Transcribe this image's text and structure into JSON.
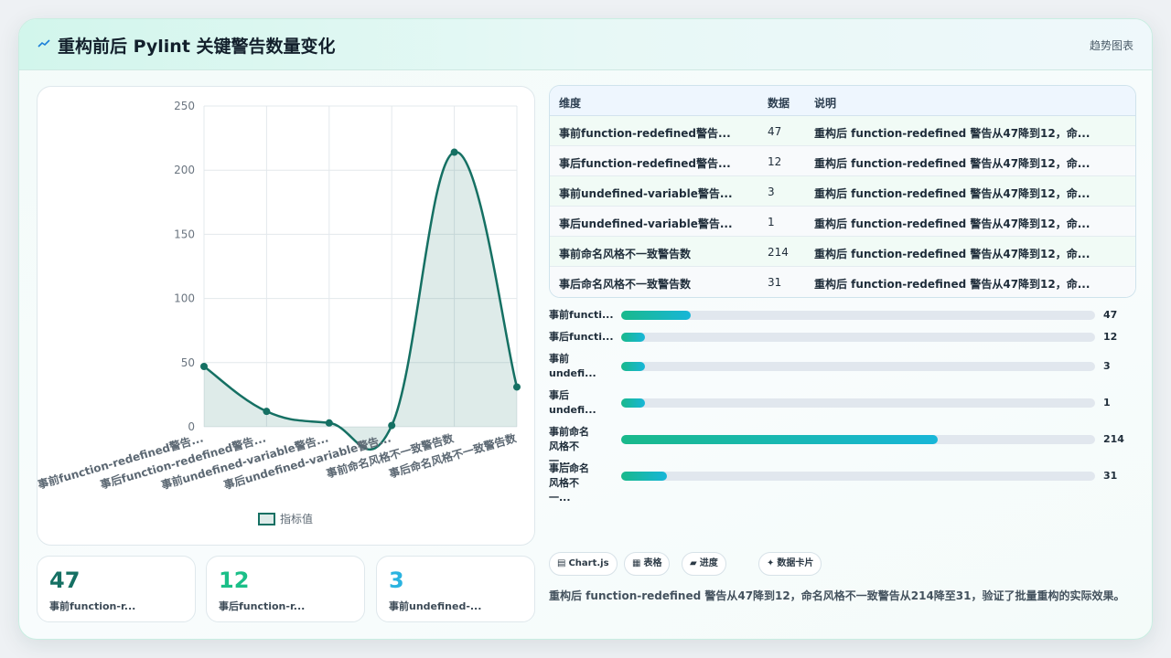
{
  "header": {
    "logo_icon": "trend-icon",
    "title": "重构前后 Pylint 关键警告数量变化",
    "tag": "趋势图表"
  },
  "colors": {
    "line": "#157063",
    "accent_green": "#19b98b",
    "accent_cyan": "#18b6d8",
    "kpi1": "#157063",
    "kpi2": "#1bbf88",
    "kpi3": "#2ab3e0"
  },
  "chart_data": {
    "type": "area",
    "categories": [
      "事前function-redefined警告...",
      "事后function-redefined警告...",
      "事前undefined-variable警告...",
      "事后undefined-variable警告...",
      "事前命名风格不一致警告数",
      "事后命名风格不一致警告数"
    ],
    "series": [
      {
        "name": "指标值",
        "values": [
          47,
          12,
          3,
          1,
          214,
          31
        ]
      }
    ],
    "ylim": [
      0,
      250
    ],
    "yticks": [
      "0",
      "50",
      "100",
      "150",
      "200",
      "250"
    ],
    "grid": true,
    "legend": "bottom"
  },
  "kpis": [
    {
      "value": "47",
      "label": "事前function-r..."
    },
    {
      "value": "12",
      "label": "事后function-r..."
    },
    {
      "value": "3",
      "label": "事前undefined-..."
    }
  ],
  "table": {
    "headers": [
      "维度",
      "数据",
      "说明"
    ],
    "rows": [
      [
        "事前function-redefined警告...",
        "47",
        "重构后 function-redefined 警告从47降到12，命..."
      ],
      [
        "事后function-redefined警告...",
        "12",
        "重构后 function-redefined 警告从47降到12，命..."
      ],
      [
        "事前undefined-variable警告...",
        "3",
        "重构后 function-redefined 警告从47降到12，命..."
      ],
      [
        "事后undefined-variable警告...",
        "1",
        "重构后 function-redefined 警告从47降到12，命..."
      ],
      [
        "事前命名风格不一致警告数",
        "214",
        "重构后 function-redefined 警告从47降到12，命..."
      ],
      [
        "事后命名风格不一致警告数",
        "31",
        "重构后 function-redefined 警告从47降到12，命..."
      ]
    ]
  },
  "progress": {
    "max": 320,
    "items": [
      {
        "label": "事前functi...",
        "value": 47
      },
      {
        "label": "事后functi...",
        "value": 12
      },
      {
        "label": "事前undefi...",
        "value": 3
      },
      {
        "label": "事后undefi...",
        "value": 1
      },
      {
        "label": "事前命名风格不一...",
        "value": 214
      },
      {
        "label": "事后命名风格不一...",
        "value": 31
      }
    ]
  },
  "chips": [
    {
      "icon": "chart-icon",
      "glyph": "▤",
      "label": "Chart.js"
    },
    {
      "icon": "table-icon",
      "glyph": "▦",
      "label": "表格"
    },
    {
      "icon": "progress-icon",
      "glyph": "▰",
      "label": "进度"
    },
    {
      "icon": "sparkle-icon",
      "glyph": "✦",
      "label": "数据卡片"
    }
  ],
  "summary": "重构后 function-redefined 警告从47降到12，命名风格不一致警告从214降至31，验证了批量重构的实际效果。"
}
